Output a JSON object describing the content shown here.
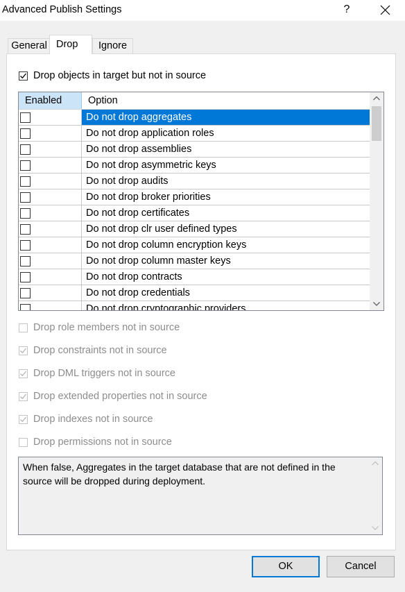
{
  "window": {
    "title": "Advanced Publish Settings",
    "help_label": "?"
  },
  "tabs": [
    {
      "label": "General",
      "active": false
    },
    {
      "label": "Drop",
      "active": true
    },
    {
      "label": "Ignore",
      "active": false
    }
  ],
  "main_option": {
    "label": "Drop objects in target but not in source",
    "checked": true
  },
  "grid": {
    "columns": [
      "Enabled",
      "Option"
    ],
    "rows": [
      {
        "enabled": false,
        "label": "Do not drop aggregates",
        "selected": true
      },
      {
        "enabled": false,
        "label": "Do not drop application roles"
      },
      {
        "enabled": false,
        "label": "Do not drop assemblies"
      },
      {
        "enabled": false,
        "label": "Do not drop asymmetric keys"
      },
      {
        "enabled": false,
        "label": "Do not drop audits"
      },
      {
        "enabled": false,
        "label": "Do not drop broker priorities"
      },
      {
        "enabled": false,
        "label": "Do not drop certificates"
      },
      {
        "enabled": false,
        "label": "Do not drop clr user defined types"
      },
      {
        "enabled": false,
        "label": "Do not drop column encryption keys"
      },
      {
        "enabled": false,
        "label": "Do not drop column master keys"
      },
      {
        "enabled": false,
        "label": "Do not drop contracts"
      },
      {
        "enabled": false,
        "label": "Do not drop credentials"
      },
      {
        "enabled": false,
        "label": "Do not drop cryptographic providers"
      }
    ]
  },
  "secondary_options": [
    {
      "label": "Drop role members not in source",
      "checked": false
    },
    {
      "label": "Drop constraints not in source",
      "checked": true
    },
    {
      "label": "Drop DML triggers not in source",
      "checked": true
    },
    {
      "label": "Drop extended properties not in source",
      "checked": true
    },
    {
      "label": "Drop indexes not in source",
      "checked": true
    },
    {
      "label": "Drop permissions not in source",
      "checked": false
    }
  ],
  "description": "When false, Aggregates in the target database that are not defined in the source will be dropped during deployment.",
  "buttons": {
    "ok": "OK",
    "cancel": "Cancel"
  },
  "colors": {
    "accent": "#0078d7",
    "header_highlight": "#cce4f7"
  }
}
